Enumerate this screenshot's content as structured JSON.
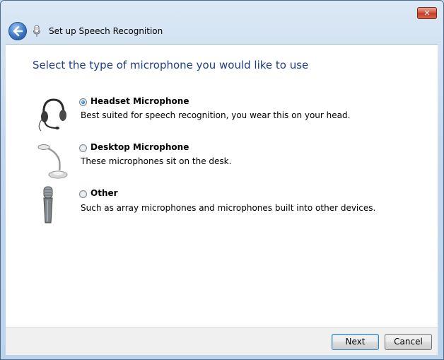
{
  "window": {
    "title": "Set up Speech Recognition",
    "close_glyph": "✕",
    "back_icon": "back-arrow-icon",
    "title_icon": "microphone-icon"
  },
  "main": {
    "heading": "Select the type of microphone you would like to use",
    "options": [
      {
        "label": "Headset Microphone",
        "description": "Best suited for speech recognition, you wear this on your head.",
        "selected": true,
        "icon": "headset-icon"
      },
      {
        "label": "Desktop Microphone",
        "description": "These microphones sit on the desk.",
        "selected": false,
        "icon": "desktop-microphone-icon"
      },
      {
        "label": "Other",
        "description": "Such as array microphones and microphones built into other devices.",
        "selected": false,
        "icon": "handheld-microphone-icon"
      }
    ]
  },
  "footer": {
    "next_label": "Next",
    "cancel_label": "Cancel"
  },
  "colors": {
    "heading": "#1e3f8a",
    "chrome": "#c4d8ee",
    "close": "#c23a22"
  }
}
